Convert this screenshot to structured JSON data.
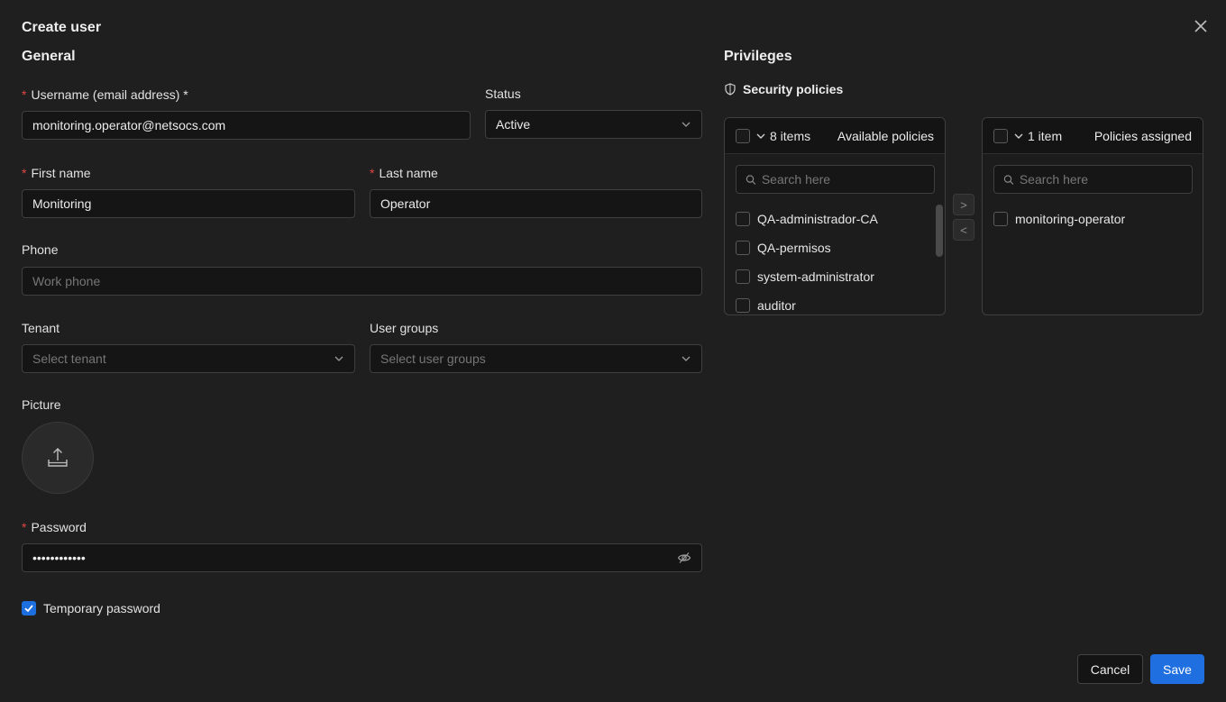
{
  "dialog": {
    "title": "Create user"
  },
  "general": {
    "heading": "General",
    "username": {
      "label": "Username (email address) *",
      "value": "monitoring.operator@netsocs.com"
    },
    "status": {
      "label": "Status",
      "value": "Active"
    },
    "first_name": {
      "label": "First name",
      "value": "Monitoring"
    },
    "last_name": {
      "label": "Last name",
      "value": "Operator"
    },
    "phone": {
      "label": "Phone",
      "placeholder": "Work phone"
    },
    "tenant": {
      "label": "Tenant",
      "placeholder": "Select tenant"
    },
    "user_groups": {
      "label": "User groups",
      "placeholder": "Select user groups"
    },
    "picture": {
      "label": "Picture"
    },
    "password": {
      "label": "Password",
      "masked_value": "••••••••••••"
    },
    "temporary_password": {
      "label": "Temporary password",
      "checked": true
    }
  },
  "privileges": {
    "heading": "Privileges",
    "security_policies_label": "Security policies",
    "available": {
      "count_label": "8 items",
      "title": "Available policies",
      "search_placeholder": "Search here",
      "items": [
        {
          "label": "QA-administrador-CA"
        },
        {
          "label": "QA-permisos"
        },
        {
          "label": "system-administrator"
        },
        {
          "label": "auditor"
        }
      ]
    },
    "assigned": {
      "count_label": "1 item",
      "title": "Policies assigned",
      "search_placeholder": "Search here",
      "items": [
        {
          "label": "monitoring-operator"
        }
      ]
    },
    "move_right_label": ">",
    "move_left_label": "<"
  },
  "footer": {
    "cancel_label": "Cancel",
    "save_label": "Save"
  },
  "colors": {
    "accent": "#1f6fe0",
    "required": "#e04545",
    "background": "#1f1f1f"
  }
}
